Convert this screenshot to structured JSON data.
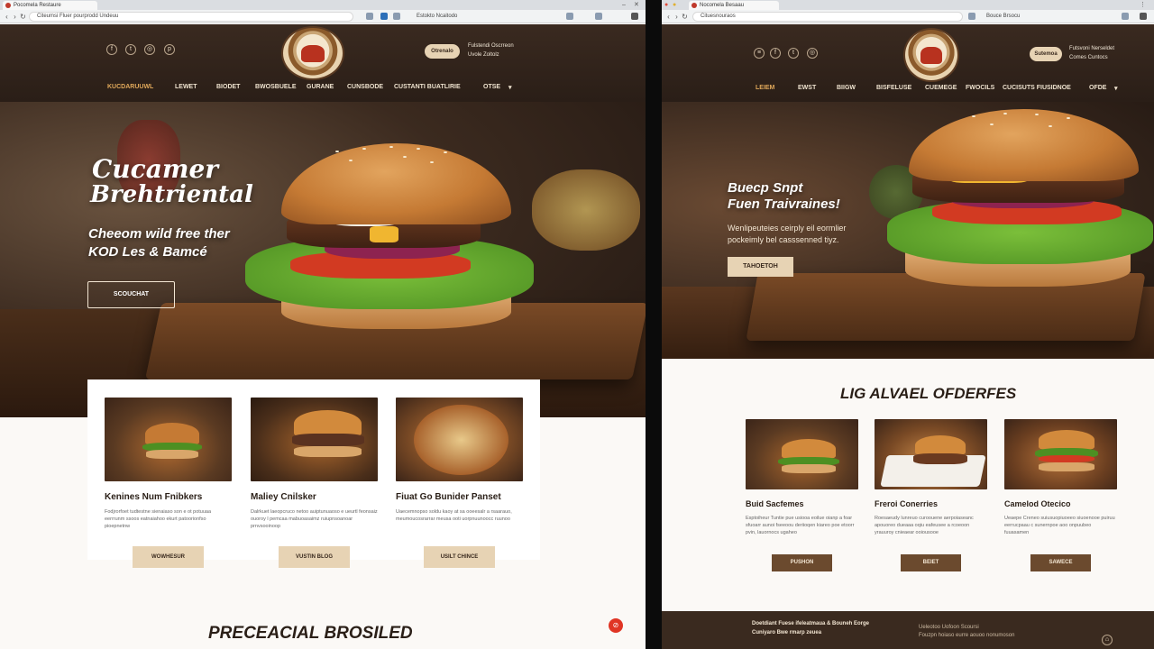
{
  "left_window": {
    "tab_title": "Pocomela Restaure",
    "url": "Citeumsi Fluer pourprodd Undeuu",
    "ext_text": "Estokto Ncaitodo",
    "header": {
      "button_label": "Otrenalo",
      "contact_lines": [
        "Fulstendi Oscrreon",
        "Uvole   Zoltolz"
      ],
      "nav": [
        "KUCDARUUWL",
        "LEWET",
        "BIODET",
        "BWOSBUELE",
        "GURANE",
        "CUNSBODE",
        "CUSTANTI BUATLIRIE",
        "OTSE"
      ],
      "nav_active_index": 0
    },
    "hero": {
      "title_line1": "Cucamer",
      "title_line2": "Brehtriental",
      "subtitle_line1": "Cheeom wild free ther",
      "subtitle_line2": "KOD Les & Bamcé",
      "button_label": "SCOUCHAT"
    },
    "cards": [
      {
        "title": "Kenines Num Fnibkers",
        "text": "Fodjrorfoet tudtestne sienaiaso son e ot potuuaa eerrrunm ssoos eatnaiahoo ekurt patoorionfso pioepnetnw",
        "button": "WOWHESUR"
      },
      {
        "title": "Maliey Cnilsker",
        "text": "Dalrkuet laeopcruco netoo auiptunuaoso e ueurtl feonsaiz ouoroy l pemcaa mabuoasaimz ruiupnsoanoar prnvsooinoop",
        "button": "VUSTIN BLOG"
      },
      {
        "title": "Fiuat Go Bunider Panset",
        "text": "Uaecemnopso soldu kaoy at sa ooeesalr a rsaarauo, meumoucosrarrar meusa ooti uorpnuunoocc ruunoo",
        "button": "USILT CHINCE"
      }
    ],
    "section_title": "PRECEACIAL BROSILED"
  },
  "right_window": {
    "tab_title": "Nocomela Besaau",
    "url": "Cituesnouraos",
    "ext_text": "Bouce Brsocu",
    "header": {
      "button_label": "Sutemoa",
      "contact_lines": [
        "Futsvoni Nerseldet",
        "Comes   Cuntocs"
      ],
      "nav": [
        "LEIEM",
        "EWST",
        "BIIGW",
        "BISFELUSE",
        "CUEMEGE",
        "FWOCILS",
        "CUCISUTS FIUSIDNOE",
        "OFDE"
      ],
      "nav_active_index": 0
    },
    "hero": {
      "title_line1": "Buecp Snpt",
      "title_line2": "Fuen Traivraines!",
      "text_line1": "Wenlipeuteies ceirply eil eormlier",
      "text_line2": "pockeimly bel casssenned tiyz.",
      "button_label": "TAHOETOH"
    },
    "section_title": "LIG ALVAEL OFDERFES",
    "cards": [
      {
        "title": "Buid Sacfemes",
        "text": "Esptoiheur Tuntie pue usiooa eoilue oianp a foar sfuoarr aunoi fseeoou deriioqen kiareo poe etoorr pvin, lauornocs ugaheo",
        "button": "PUSHON"
      },
      {
        "title": "Freroi Conerries",
        "text": "Roesaeudy lunreuo curoouene aerpoiaseanc apouoreo dueaaa oqiu eafeusee a rcoeoon yrauuroy cnieaear ooiousooe",
        "button": "BEIET"
      },
      {
        "title": "Camelod Otecico",
        "text": "Ueaepe Creneo suiusuopiuoeeo siuoenooe puiruu eerrucpaau c sunernpoe aoo onpuubeo fuuasamen",
        "button": "SAWECE"
      }
    ],
    "footer_lines": [
      "Doetdiant Fuese ifeleatmaua & Bouneh Eorge",
      "Cuniyaro Bwe rmarp zeuea"
    ],
    "footer_right_lines": [
      "Ueleotoo Uofoon Scoursi",
      "Fouzpn hoiaso eurre aouoo nonumoson"
    ]
  },
  "colors": {
    "header_bg": "#2a1e17",
    "accent_tan": "#e7d3b4",
    "brown_button": "#6b4a2e",
    "active_nav": "#e0a85a",
    "text_dark": "#2a1f17"
  },
  "icons": [
    "facebook-icon",
    "twitter-icon",
    "instagram-icon",
    "pinterest-icon",
    "phone-icon",
    "mail-icon",
    "chevron-down-icon",
    "close-icon"
  ]
}
